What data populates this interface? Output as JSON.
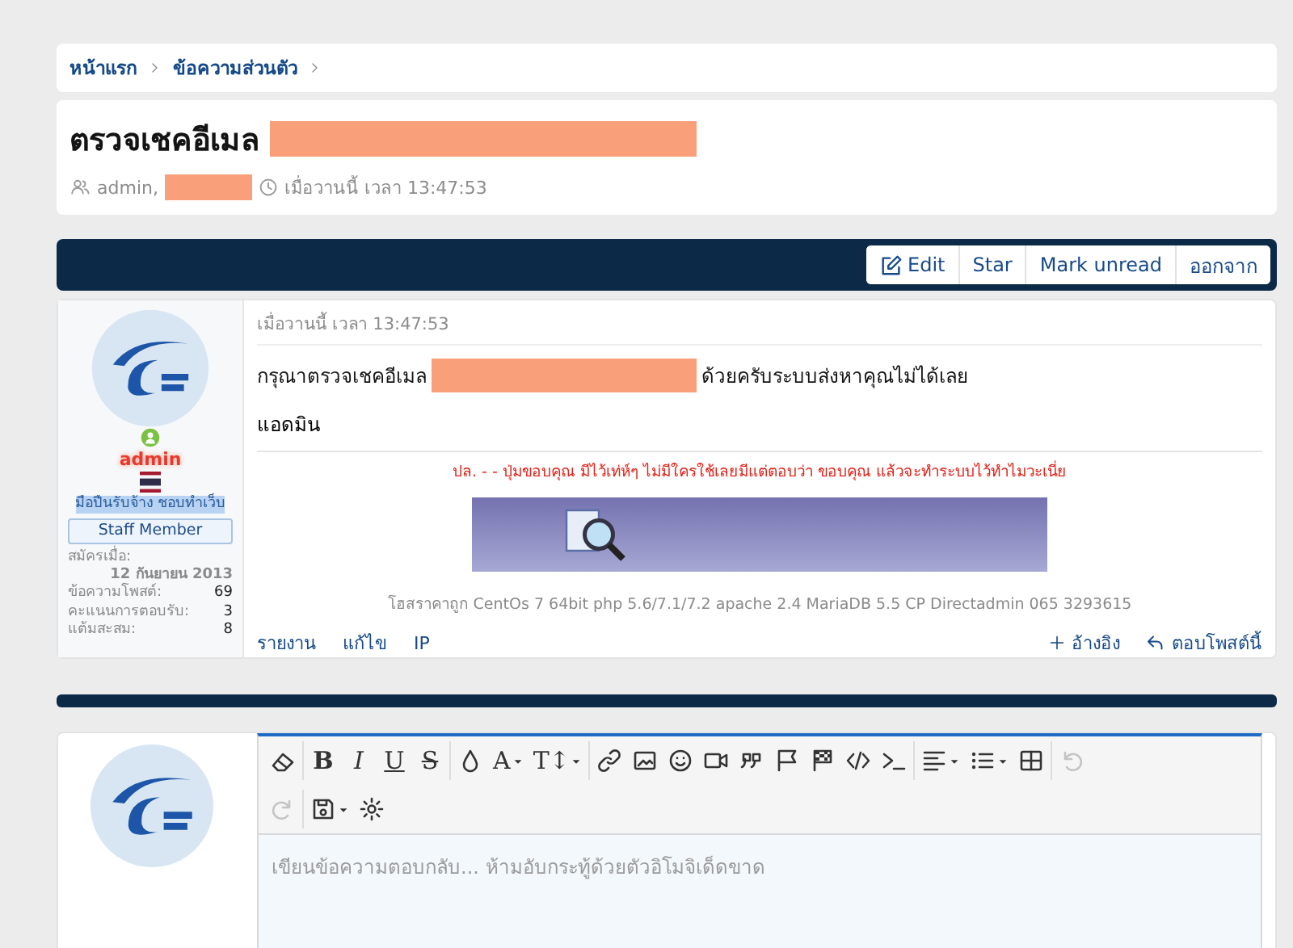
{
  "breadcrumb": [
    {
      "label": "หน้าแรก"
    },
    {
      "label": "ข้อความส่วนตัว"
    }
  ],
  "thread": {
    "title": "ตรวจเชคอีเมล",
    "title_redacted": true,
    "participants": "admin,",
    "participants_redacted": true,
    "time": "เมื่อวานนี้ เวลา 13:47:53"
  },
  "actions": [
    {
      "label": "Edit",
      "kind": "edit"
    },
    {
      "label": "Star",
      "kind": "plain"
    },
    {
      "label": "Mark unread",
      "kind": "plain"
    },
    {
      "label": "ออกจาก",
      "kind": "plain"
    }
  ],
  "post": {
    "user": {
      "name": "admin",
      "online": true,
      "title": "มือปืนรับจ้าง ชอบทำเว็บ",
      "title_highlighted": true,
      "banner": "Staff Member",
      "stats": [
        {
          "label": "สมัครเมื่อ:",
          "value": "12 กันยายน 2013",
          "kind": "stacked"
        },
        {
          "label": "ข้อความโพสต์:",
          "value": "69",
          "kind": "inline"
        },
        {
          "label": "คะแนนการตอบรับ:",
          "value": "3",
          "kind": "inline"
        },
        {
          "label": "แต้มสะสม:",
          "value": "8",
          "kind": "inline"
        }
      ]
    },
    "time": "เมื่อวานนี้ เวลา 13:47:53",
    "body_before": "กรุณาตรวจเชคอีเมล",
    "body_redacted": true,
    "body_after": "ด้วยครับระบบส่งหาคุณไม่ได้เลย",
    "signoff": "แอดมิน",
    "note": "ปล. - - ปุ่มขอบคุณ มีไว้เท่ห์ๆ ไม่มีใครใช้เลยมีแต่ตอบว่า ขอบคุณ แล้วจะทำระบบไว้ทำไมวะเนี่ย",
    "signature": "โฮสราคาถูก CentOs 7 64bit php 5.6/7.1/7.2 apache 2.4 MariaDB 5.5 CP Directadmin 065 3293615",
    "links": [
      {
        "label": "รายงาน"
      },
      {
        "label": "แก้ไข"
      },
      {
        "label": "IP"
      }
    ],
    "reply_actions": [
      {
        "label": "อ้างอิง",
        "kind": "plus"
      },
      {
        "label": "ตอบโพสต์นี้",
        "kind": "reply"
      }
    ]
  },
  "editor": {
    "toolbar": [
      {
        "kind": "icon"
      },
      {
        "kind": "separator"
      },
      {
        "kind": "bold",
        "label": "B"
      },
      {
        "kind": "italic",
        "label": "I"
      },
      {
        "kind": "underline",
        "label": "U"
      },
      {
        "kind": "strike",
        "label": "S"
      },
      {
        "kind": "separator"
      },
      {
        "kind": "icon"
      },
      {
        "kind": "text",
        "label": "A",
        "menu": true
      },
      {
        "kind": "text",
        "label": "T↕",
        "menu": true
      },
      {
        "kind": "separator"
      },
      {
        "kind": "icon"
      },
      {
        "kind": "icon"
      },
      {
        "kind": "icon"
      },
      {
        "kind": "icon"
      },
      {
        "kind": "icon"
      },
      {
        "kind": "icon"
      },
      {
        "kind": "icon"
      },
      {
        "kind": "icon"
      },
      {
        "kind": "icon"
      },
      {
        "kind": "separator"
      },
      {
        "kind": "icon",
        "menu": true
      },
      {
        "kind": "icon",
        "menu": true
      },
      {
        "kind": "icon"
      },
      {
        "kind": "separator"
      },
      {
        "kind": "icon",
        "disabled": true
      },
      {
        "kind": "break"
      },
      {
        "kind": "icon",
        "disabled": true
      },
      {
        "kind": "separator"
      },
      {
        "kind": "icon",
        "menu": true
      },
      {
        "kind": "icon"
      }
    ],
    "placeholder": "เขียนข้อความตอบกลับ... ห้ามอับกระทู้ด้วยตัวอิโมจิเด็ดขาด"
  }
}
